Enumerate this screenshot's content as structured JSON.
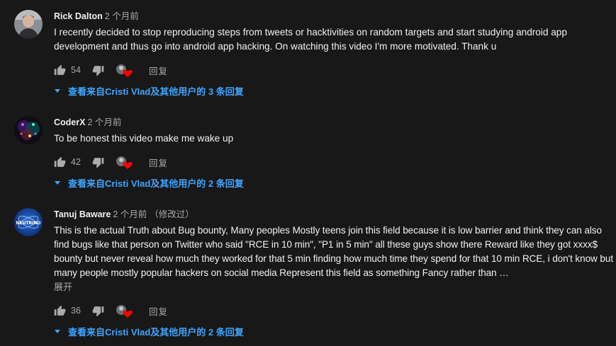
{
  "colors": {
    "background": "#181818",
    "text_primary": "#f1f1f1",
    "text_secondary": "#aaaaaa",
    "link": "#3ea6ff",
    "heart": "#ff0000"
  },
  "icons": {
    "like": "thumb-up-icon",
    "dislike": "thumb-down-icon",
    "creator_heart": "creator-heart-icon",
    "replies_caret": "caret-down-icon"
  },
  "comments": [
    {
      "author": "Rick Dalton",
      "time": "2 个月前",
      "edited": "",
      "text": "I recently decided to stop reproducing steps from tweets or hacktivities on random targets and start studying android app development and thus go into android app hacking. On watching this video I'm more motivated. Thank u",
      "expand": "",
      "likes": "54",
      "reply_label": "回复",
      "replies_label": "查看来自Cristi Vlad及其他用户的 3 条回复"
    },
    {
      "author": "CoderX",
      "time": "2 个月前",
      "edited": "",
      "text": "To be honest this video make me wake up",
      "expand": "",
      "likes": "42",
      "reply_label": "回复",
      "replies_label": "查看来自Cristi Vlad及其他用户的 2 条回复"
    },
    {
      "author": "Tanuj Baware",
      "time": "2 个月前",
      "edited": "（修改过）",
      "text": "This is the actual Truth about Bug bounty, Many peoples Mostly teens join this field because it is low barrier and think they can also find bugs like that person on Twitter who said \"RCE in 10 min\", \"P1 in 5 min\" all these guys show there Reward like they got xxxx$ bounty but never reveal how much they worked for that 5 min finding how much time they spend for that 10 min RCE, i don't know but many people mostly popular hackers on social media Represent this field as something Fancy rather than …",
      "expand": "展开",
      "likes": "36",
      "reply_label": "回复",
      "replies_label": "查看来自Cristi Vlad及其他用户的 2 条回复",
      "avatar_text": "NEUTRINO"
    }
  ]
}
